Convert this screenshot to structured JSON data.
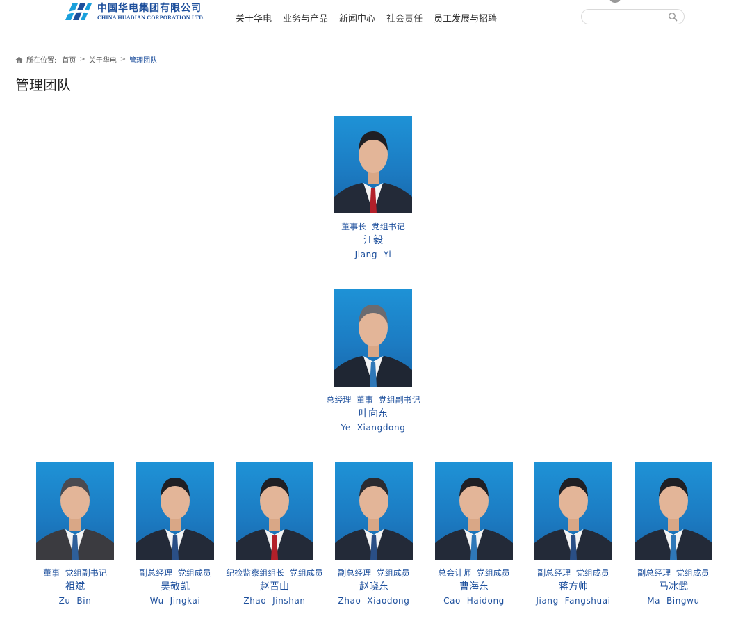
{
  "header": {
    "logo_cn": "中国华电集团有限公司",
    "logo_en": "CHINA HUADIAN CORPORATION LTD.",
    "nav": [
      "关于华电",
      "业务与产品",
      "新闻中心",
      "社会责任",
      "员工发展与招聘"
    ],
    "search": {
      "value": "",
      "placeholder": ""
    }
  },
  "breadcrumb": {
    "prefix": "所在位置:",
    "items": [
      "首页",
      "关于华电",
      "管理团队"
    ],
    "separator": ">"
  },
  "page_title": "管理团队",
  "colors": {
    "brand_blue": "#1d4f9c",
    "photo_bg": "#1e92d6"
  },
  "team": [
    {
      "title": "董事长  党组书记",
      "name": "江毅",
      "name_en": "Jiang  Yi"
    },
    {
      "title": "总经理  董事  党组副书记",
      "name": "叶向东",
      "name_en": "Ye  Xiangdong"
    },
    {
      "title": "董事  党组副书记",
      "name": "祖斌",
      "name_en": "Zu  Bin"
    },
    {
      "title": "副总经理  党组成员",
      "name": "吴敬凯",
      "name_en": "Wu  Jingkai"
    },
    {
      "title": "纪检监察组组长  党组成员",
      "name": "赵晋山",
      "name_en": "Zhao  Jinshan"
    },
    {
      "title": "副总经理  党组成员",
      "name": "赵晓东",
      "name_en": "Zhao  Xiaodong"
    },
    {
      "title": "总会计师  党组成员",
      "name": "曹海东",
      "name_en": "Cao  Haidong"
    },
    {
      "title": "副总经理  党组成员",
      "name": "蒋方帅",
      "name_en": "Jiang  Fangshuai"
    },
    {
      "title": "副总经理  党组成员",
      "name": "马冰武",
      "name_en": "Ma  Bingwu"
    }
  ]
}
